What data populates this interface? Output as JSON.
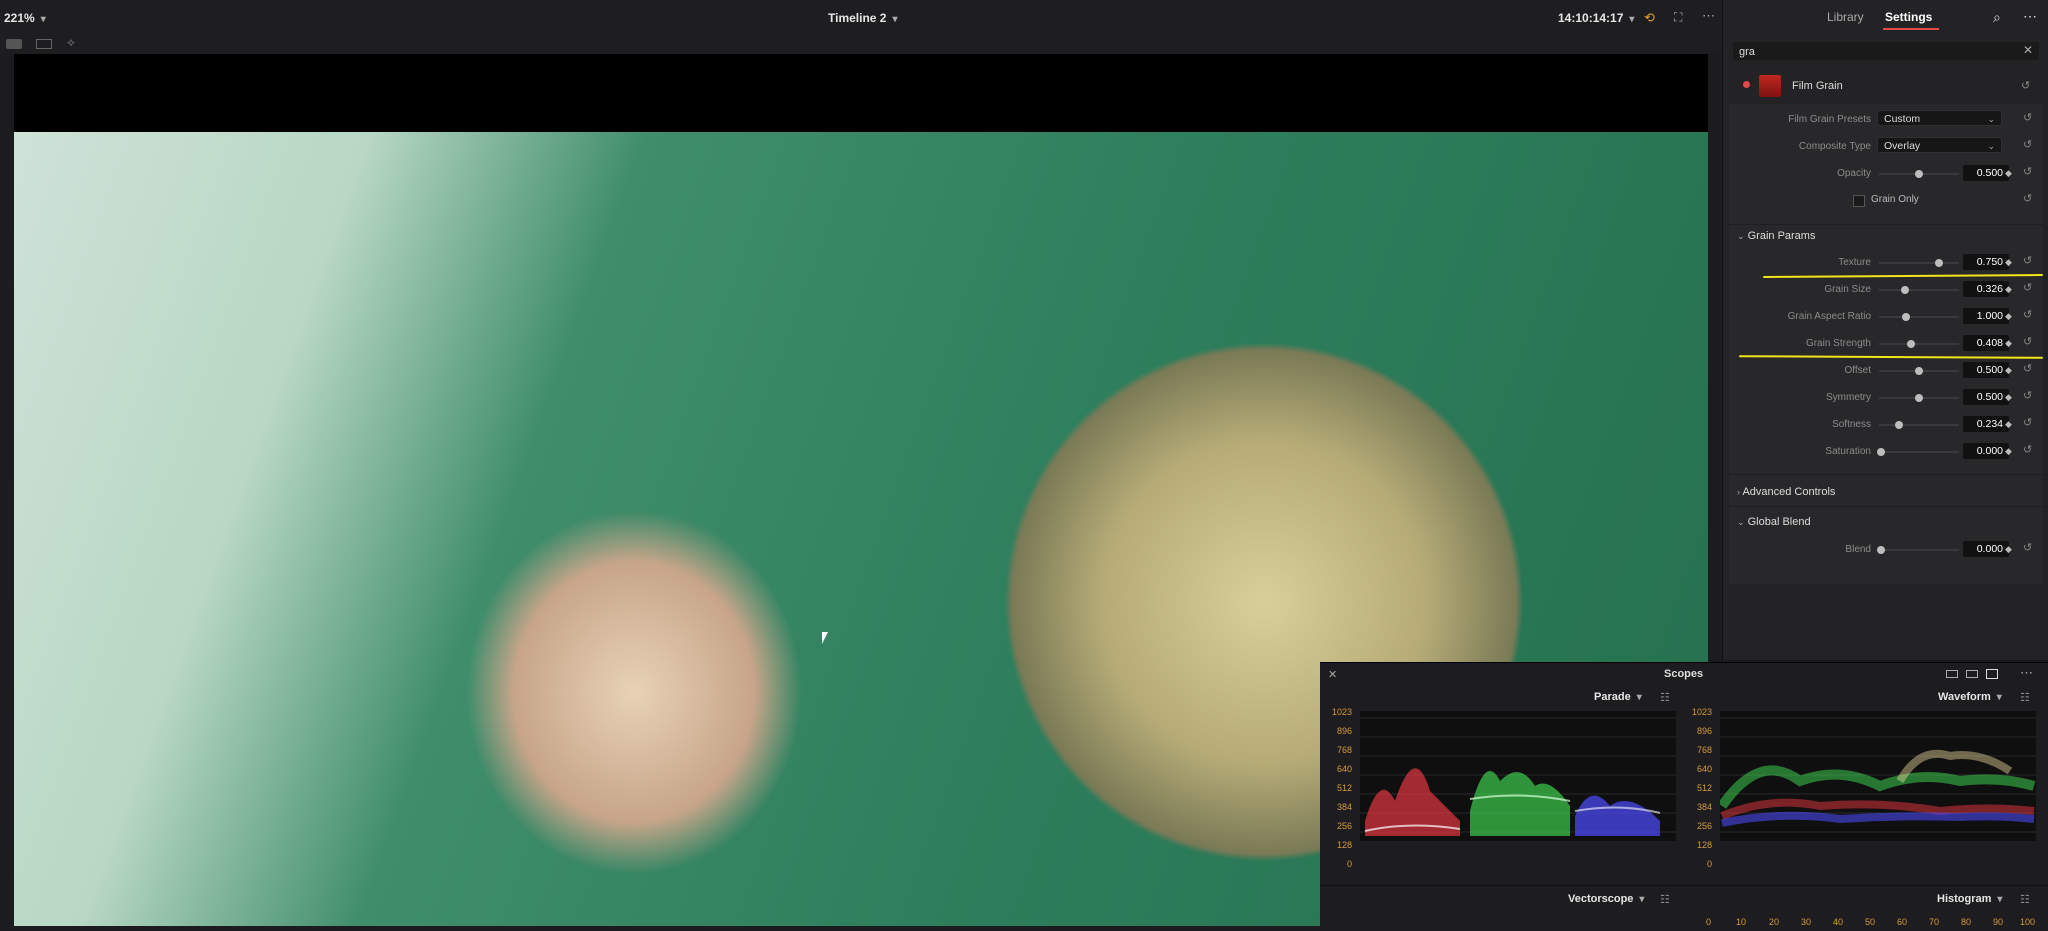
{
  "topbar": {
    "zoom": "221%",
    "timeline": "Timeline 2",
    "timecode": "14:10:14:17"
  },
  "panel": {
    "tabs": [
      {
        "label": "Library"
      },
      {
        "label": "Settings"
      }
    ],
    "search": {
      "value": "gra"
    },
    "effect_title": "Film Grain",
    "presets_label": "Film Grain Presets",
    "presets_value": "Custom",
    "composite_label": "Composite Type",
    "composite_value": "Overlay",
    "opacity": {
      "label": "Opacity",
      "value": "0.500"
    },
    "grain_only_label": "Grain Only",
    "sections": {
      "grain_params": "Grain Params",
      "advanced": "Advanced Controls",
      "global_blend": "Global Blend"
    },
    "params": [
      {
        "label": "Texture",
        "value": "0.750"
      },
      {
        "label": "Grain Size",
        "value": "0.326"
      },
      {
        "label": "Grain Aspect Ratio",
        "value": "1.000"
      },
      {
        "label": "Grain Strength",
        "value": "0.408"
      },
      {
        "label": "Offset",
        "value": "0.500"
      },
      {
        "label": "Symmetry",
        "value": "0.500"
      },
      {
        "label": "Softness",
        "value": "0.234"
      },
      {
        "label": "Saturation",
        "value": "0.000"
      }
    ],
    "blend": {
      "label": "Blend",
      "value": "0.000"
    }
  },
  "scopes": {
    "title": "Scopes",
    "top_left": "Parade",
    "top_right": "Waveform",
    "bottom_left": "Vectorscope",
    "bottom_right": "Histogram",
    "y_ticks": [
      "1023",
      "896",
      "768",
      "640",
      "512",
      "384",
      "256",
      "128",
      "0"
    ],
    "x_ticks": [
      "0",
      "10",
      "20",
      "30",
      "40",
      "50",
      "60",
      "70",
      "80",
      "90",
      "100"
    ]
  },
  "colors": {
    "accent": "#e14a4a",
    "highlight": "#f1e51d",
    "scope_tick": "#d99b3a"
  }
}
